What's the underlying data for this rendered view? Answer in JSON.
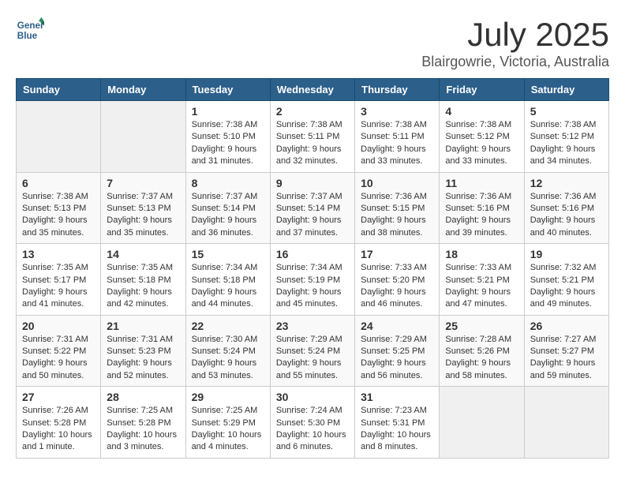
{
  "header": {
    "logo_line1": "General",
    "logo_line2": "Blue",
    "month": "July 2025",
    "location": "Blairgowrie, Victoria, Australia"
  },
  "days_of_week": [
    "Sunday",
    "Monday",
    "Tuesday",
    "Wednesday",
    "Thursday",
    "Friday",
    "Saturday"
  ],
  "weeks": [
    [
      {
        "day": "",
        "info": ""
      },
      {
        "day": "",
        "info": ""
      },
      {
        "day": "1",
        "info": "Sunrise: 7:38 AM\nSunset: 5:10 PM\nDaylight: 9 hours\nand 31 minutes."
      },
      {
        "day": "2",
        "info": "Sunrise: 7:38 AM\nSunset: 5:11 PM\nDaylight: 9 hours\nand 32 minutes."
      },
      {
        "day": "3",
        "info": "Sunrise: 7:38 AM\nSunset: 5:11 PM\nDaylight: 9 hours\nand 33 minutes."
      },
      {
        "day": "4",
        "info": "Sunrise: 7:38 AM\nSunset: 5:12 PM\nDaylight: 9 hours\nand 33 minutes."
      },
      {
        "day": "5",
        "info": "Sunrise: 7:38 AM\nSunset: 5:12 PM\nDaylight: 9 hours\nand 34 minutes."
      }
    ],
    [
      {
        "day": "6",
        "info": "Sunrise: 7:38 AM\nSunset: 5:13 PM\nDaylight: 9 hours\nand 35 minutes."
      },
      {
        "day": "7",
        "info": "Sunrise: 7:37 AM\nSunset: 5:13 PM\nDaylight: 9 hours\nand 35 minutes."
      },
      {
        "day": "8",
        "info": "Sunrise: 7:37 AM\nSunset: 5:14 PM\nDaylight: 9 hours\nand 36 minutes."
      },
      {
        "day": "9",
        "info": "Sunrise: 7:37 AM\nSunset: 5:14 PM\nDaylight: 9 hours\nand 37 minutes."
      },
      {
        "day": "10",
        "info": "Sunrise: 7:36 AM\nSunset: 5:15 PM\nDaylight: 9 hours\nand 38 minutes."
      },
      {
        "day": "11",
        "info": "Sunrise: 7:36 AM\nSunset: 5:16 PM\nDaylight: 9 hours\nand 39 minutes."
      },
      {
        "day": "12",
        "info": "Sunrise: 7:36 AM\nSunset: 5:16 PM\nDaylight: 9 hours\nand 40 minutes."
      }
    ],
    [
      {
        "day": "13",
        "info": "Sunrise: 7:35 AM\nSunset: 5:17 PM\nDaylight: 9 hours\nand 41 minutes."
      },
      {
        "day": "14",
        "info": "Sunrise: 7:35 AM\nSunset: 5:18 PM\nDaylight: 9 hours\nand 42 minutes."
      },
      {
        "day": "15",
        "info": "Sunrise: 7:34 AM\nSunset: 5:18 PM\nDaylight: 9 hours\nand 44 minutes."
      },
      {
        "day": "16",
        "info": "Sunrise: 7:34 AM\nSunset: 5:19 PM\nDaylight: 9 hours\nand 45 minutes."
      },
      {
        "day": "17",
        "info": "Sunrise: 7:33 AM\nSunset: 5:20 PM\nDaylight: 9 hours\nand 46 minutes."
      },
      {
        "day": "18",
        "info": "Sunrise: 7:33 AM\nSunset: 5:21 PM\nDaylight: 9 hours\nand 47 minutes."
      },
      {
        "day": "19",
        "info": "Sunrise: 7:32 AM\nSunset: 5:21 PM\nDaylight: 9 hours\nand 49 minutes."
      }
    ],
    [
      {
        "day": "20",
        "info": "Sunrise: 7:31 AM\nSunset: 5:22 PM\nDaylight: 9 hours\nand 50 minutes."
      },
      {
        "day": "21",
        "info": "Sunrise: 7:31 AM\nSunset: 5:23 PM\nDaylight: 9 hours\nand 52 minutes."
      },
      {
        "day": "22",
        "info": "Sunrise: 7:30 AM\nSunset: 5:24 PM\nDaylight: 9 hours\nand 53 minutes."
      },
      {
        "day": "23",
        "info": "Sunrise: 7:29 AM\nSunset: 5:24 PM\nDaylight: 9 hours\nand 55 minutes."
      },
      {
        "day": "24",
        "info": "Sunrise: 7:29 AM\nSunset: 5:25 PM\nDaylight: 9 hours\nand 56 minutes."
      },
      {
        "day": "25",
        "info": "Sunrise: 7:28 AM\nSunset: 5:26 PM\nDaylight: 9 hours\nand 58 minutes."
      },
      {
        "day": "26",
        "info": "Sunrise: 7:27 AM\nSunset: 5:27 PM\nDaylight: 9 hours\nand 59 minutes."
      }
    ],
    [
      {
        "day": "27",
        "info": "Sunrise: 7:26 AM\nSunset: 5:28 PM\nDaylight: 10 hours\nand 1 minute."
      },
      {
        "day": "28",
        "info": "Sunrise: 7:25 AM\nSunset: 5:28 PM\nDaylight: 10 hours\nand 3 minutes."
      },
      {
        "day": "29",
        "info": "Sunrise: 7:25 AM\nSunset: 5:29 PM\nDaylight: 10 hours\nand 4 minutes."
      },
      {
        "day": "30",
        "info": "Sunrise: 7:24 AM\nSunset: 5:30 PM\nDaylight: 10 hours\nand 6 minutes."
      },
      {
        "day": "31",
        "info": "Sunrise: 7:23 AM\nSunset: 5:31 PM\nDaylight: 10 hours\nand 8 minutes."
      },
      {
        "day": "",
        "info": ""
      },
      {
        "day": "",
        "info": ""
      }
    ]
  ]
}
